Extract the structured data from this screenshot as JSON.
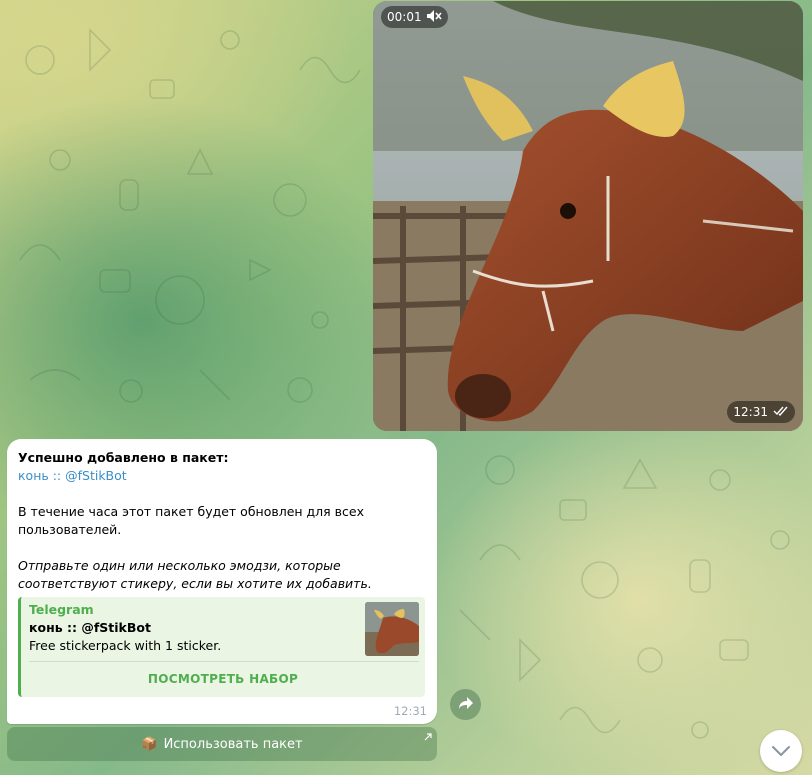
{
  "video": {
    "elapsed": "00:01",
    "time": "12:31"
  },
  "message": {
    "line1": "Успешно добавлено в пакет:",
    "link": "конь :: @fStikBot",
    "para1": "В течение часа этот пакет будет обновлен для всех пользователей.",
    "para2": "Отправьте один или несколько эмодзи, которые соответствуют стикеру, если вы хотите их добавить.",
    "time": "12:31"
  },
  "preview": {
    "site": "Telegram",
    "title": "конь :: @fStikBot",
    "description": "Free stickerpack with 1 sticker.",
    "button": "ПОСМОТРЕТЬ НАБОР"
  },
  "keyboard": {
    "button_emoji": "📦",
    "button_label": "Использовать пакет"
  },
  "colors": {
    "accent_green": "#4fae4e",
    "link_blue": "#3a8fc7"
  }
}
